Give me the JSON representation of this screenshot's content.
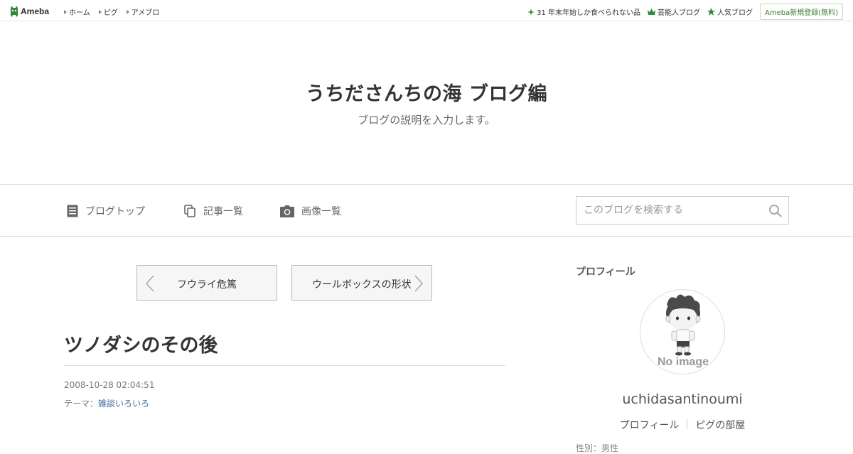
{
  "topbar": {
    "logo_text": "Ameba",
    "nav": [
      {
        "label": "ホーム"
      },
      {
        "label": "ピグ"
      },
      {
        "label": "アメブロ"
      }
    ],
    "right_links": [
      {
        "label": "31 年末年始しか食べられない品",
        "icon": "sparkle-icon"
      },
      {
        "label": "芸能人ブログ",
        "icon": "crown-icon"
      },
      {
        "label": "人気ブログ",
        "icon": "star-icon"
      }
    ],
    "register_label": "Ameba新規登録(無料)"
  },
  "header": {
    "title": "うちださんちの海 ブログ編",
    "description": "ブログの説明を入力します。"
  },
  "nav": {
    "items": [
      {
        "label": "ブログトップ",
        "icon": "document-icon"
      },
      {
        "label": "記事一覧",
        "icon": "copy-icon"
      },
      {
        "label": "画像一覧",
        "icon": "camera-icon"
      }
    ],
    "search_placeholder": "このブログを検索する"
  },
  "article": {
    "prev_label": "フウライ危篤",
    "next_label": "ウールボックスの形状",
    "title": "ツノダシのその後",
    "date": "2008-10-28 02:04:51",
    "theme_prefix": "テーマ：",
    "theme": "雑談いろいろ"
  },
  "sidebar": {
    "heading": "プロフィール",
    "avatar_text": "No image",
    "username": "uchidasantinoumi",
    "links": [
      {
        "label": "プロフィール"
      },
      {
        "label": "ピグの部屋"
      }
    ],
    "cut_text": "性別：男性"
  },
  "colors": {
    "brand_green": "#2e8b3a",
    "link_blue": "#3a6fa0"
  }
}
